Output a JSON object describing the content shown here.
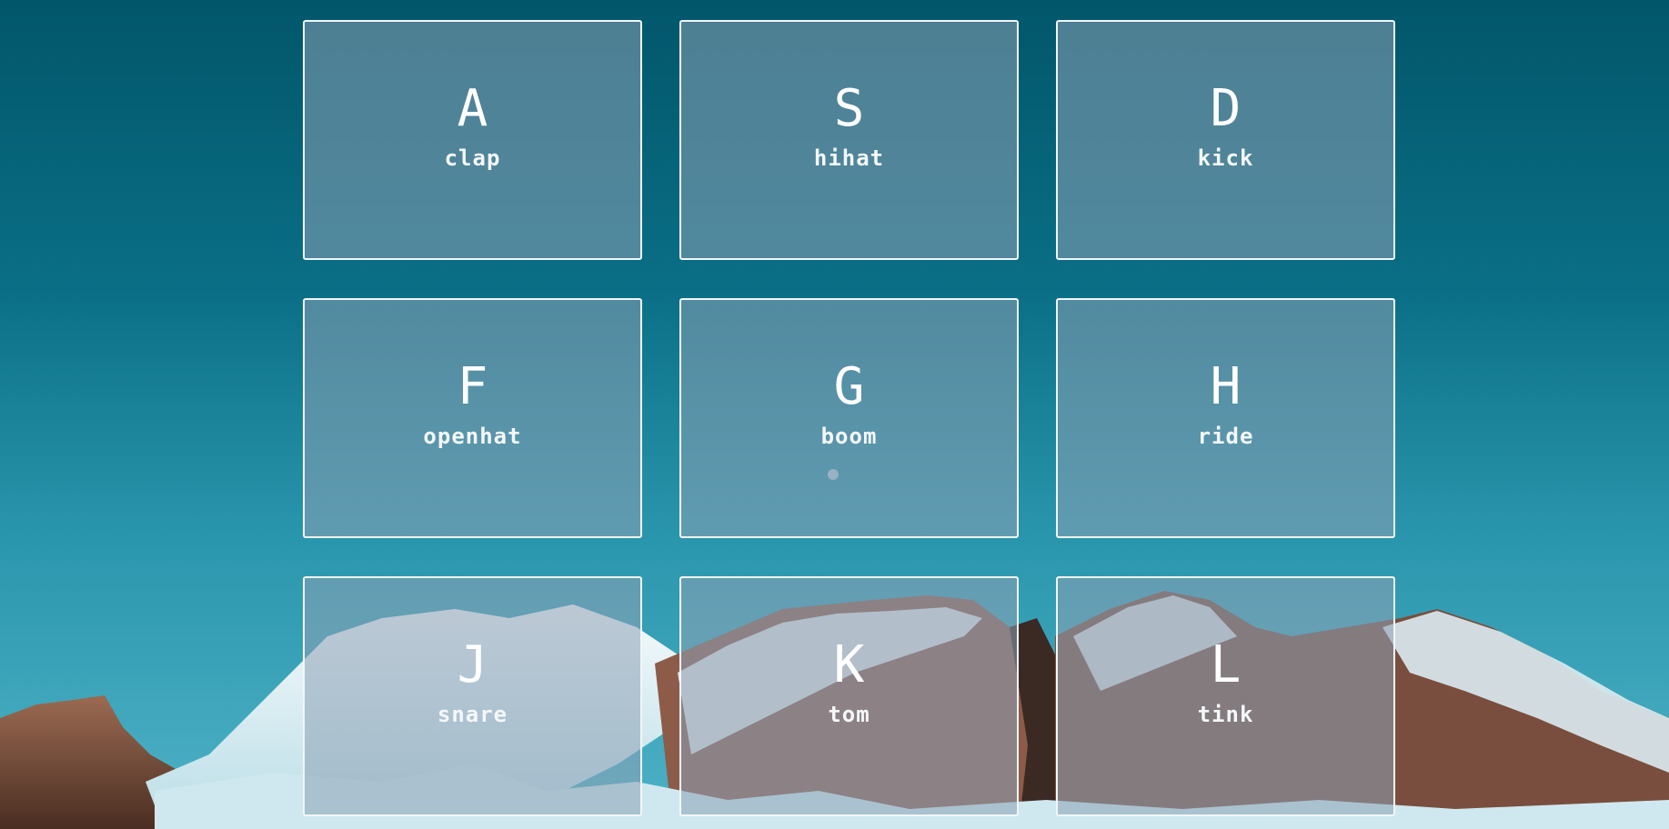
{
  "background": {
    "scene": "mountain-landscape",
    "sky_color_top": "#02566a",
    "sky_color_bottom": "#4fb2c6",
    "snow_color": "#e6f0f4",
    "rock_color": "#8a5a45"
  },
  "pads": [
    {
      "key": "A",
      "sound": "clap"
    },
    {
      "key": "S",
      "sound": "hihat"
    },
    {
      "key": "D",
      "sound": "kick"
    },
    {
      "key": "F",
      "sound": "openhat"
    },
    {
      "key": "G",
      "sound": "boom"
    },
    {
      "key": "H",
      "sound": "ride"
    },
    {
      "key": "J",
      "sound": "snare"
    },
    {
      "key": "K",
      "sound": "tom"
    },
    {
      "key": "L",
      "sound": "tink"
    }
  ]
}
